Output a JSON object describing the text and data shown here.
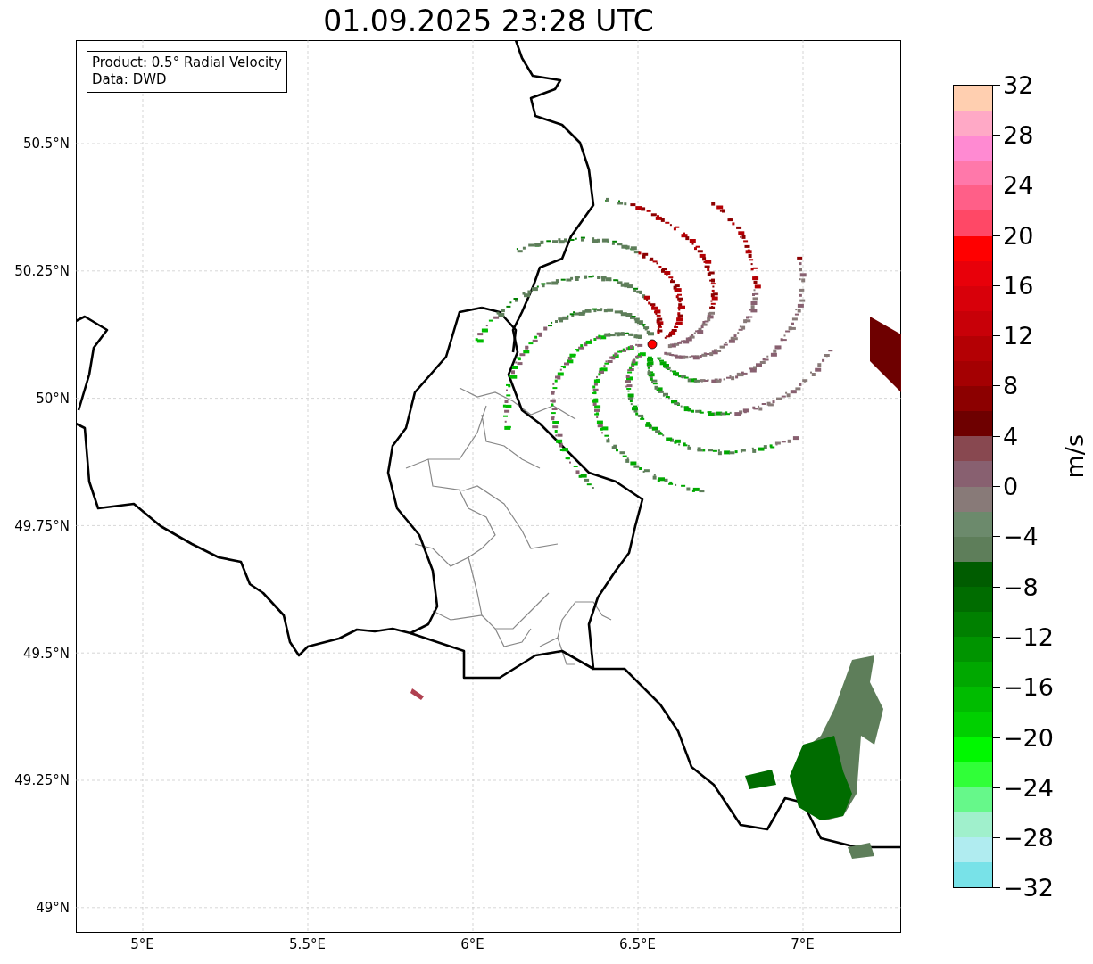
{
  "title": "01.09.2025 23:28 UTC",
  "map": {
    "legend": [
      "Product: 0.5° Radial Velocity",
      "Data: DWD"
    ],
    "lat_labels": [
      "50.5°N",
      "50.25°N",
      "50°N",
      "49.75°N",
      "49.5°N",
      "49.25°N",
      "49°N"
    ],
    "lon_labels": [
      "5°E",
      "5.5°E",
      "6°E",
      "6.5°E",
      "7°E"
    ]
  },
  "colorbar": {
    "label": "m/s",
    "ticks": [
      "32",
      "28",
      "24",
      "20",
      "16",
      "12",
      "8",
      "4",
      "0",
      "−4",
      "−8",
      "−12",
      "−16",
      "−20",
      "−24",
      "−28",
      "−32"
    ],
    "segments": [
      {
        "color": "#ffcfb0"
      },
      {
        "color": "#ffa9c6"
      },
      {
        "color": "#ff8ad2"
      },
      {
        "color": "#ff78aa"
      },
      {
        "color": "#ff5f88"
      },
      {
        "color": "#ff4866"
      },
      {
        "color": "#ff0000"
      },
      {
        "color": "#e8000a"
      },
      {
        "color": "#d8000a"
      },
      {
        "color": "#c80008"
      },
      {
        "color": "#b40004"
      },
      {
        "color": "#a40002"
      },
      {
        "color": "#8c0000"
      },
      {
        "color": "#6e0000"
      },
      {
        "color": "#884850"
      },
      {
        "color": "#886070"
      },
      {
        "color": "#887a78"
      },
      {
        "color": "#6c8a6c"
      },
      {
        "color": "#5e7e5a"
      },
      {
        "color": "#005c00"
      },
      {
        "color": "#006c00"
      },
      {
        "color": "#008000"
      },
      {
        "color": "#009400"
      },
      {
        "color": "#00a800"
      },
      {
        "color": "#00bc00"
      },
      {
        "color": "#00d000"
      },
      {
        "color": "#00f800"
      },
      {
        "color": "#30ff38"
      },
      {
        "color": "#66f88a"
      },
      {
        "color": "#a0f0cc"
      },
      {
        "color": "#b0ecf0"
      },
      {
        "color": "#78e2e8"
      }
    ]
  }
}
